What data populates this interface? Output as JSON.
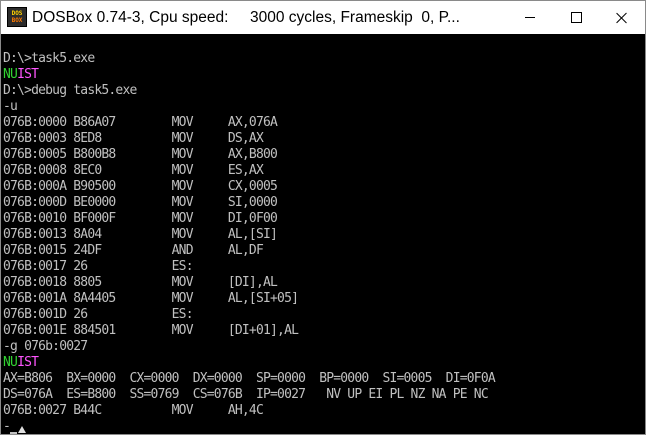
{
  "window": {
    "title": "DOSBox 0.74-3, Cpu speed:     3000 cycles, Frameskip  0, P...",
    "icon_top": "DOS",
    "icon_bottom": "BOX"
  },
  "terminal": {
    "lines": [
      "",
      "D:\\>task5.exe",
      null,
      "D:\\>debug task5.exe",
      "-u",
      "076B:0000 B86A07        MOV     AX,076A",
      "076B:0003 8ED8          MOV     DS,AX",
      "076B:0005 B800B8        MOV     AX,B800",
      "076B:0008 8EC0          MOV     ES,AX",
      "076B:000A B90500        MOV     CX,0005",
      "076B:000D BE0000        MOV     SI,0000",
      "076B:0010 BF000F        MOV     DI,0F00",
      "076B:0013 8A04          MOV     AL,[SI]",
      "076B:0015 24DF          AND     AL,DF",
      "076B:0017 26            ES:",
      "076B:0018 8805          MOV     [DI],AL",
      "076B:001A 8A4405        MOV     AL,[SI+05]",
      "076B:001D 26            ES:",
      "076B:001E 884501        MOV     [DI+01],AL",
      "-g 076b:0027",
      null,
      "AX=B806  BX=0000  CX=0000  DX=0000  SP=0000  BP=0000  SI=0005  DI=0F0A",
      "DS=076A  ES=B800  SS=0769  CS=076B  IP=0027   NV UP EI PL NZ NA PE NC",
      "076B:0027 B44C          MOV     AH,4C",
      "-"
    ],
    "nuist_first": {
      "part1": "NU",
      "part2": "IST"
    },
    "nuist_second": {
      "part1": "NU",
      "part2": "IST"
    },
    "colors": {
      "background": "#000000",
      "text": "#c0c0c0",
      "green": "#32d232",
      "magenta": "#ff55ff"
    }
  }
}
